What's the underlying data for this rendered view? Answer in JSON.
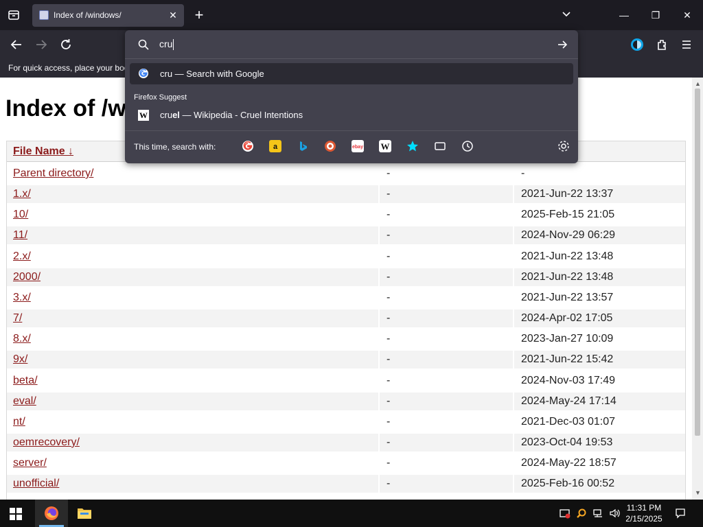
{
  "browser": {
    "tab_title": "Index of /windows/",
    "bookmarks_hint": "For quick access, place your boo"
  },
  "urlbar": {
    "typed": "cru",
    "google_row": "cru — Search with Google",
    "suggest_header": "Firefox Suggest",
    "wiki_typed": "cru",
    "wiki_completion": "el",
    "wiki_rest": " — Wikipedia - Cruel Intentions",
    "this_time_label": "This time, search with:",
    "engines": [
      "google-icon",
      "amazon-icon",
      "bing-icon",
      "duckduckgo-icon",
      "ebay-icon",
      "wikipedia-icon",
      "bookmarks-star-icon",
      "tabs-icon",
      "history-icon"
    ]
  },
  "page": {
    "heading": "Index of /w",
    "col_name": "File Name ↓",
    "rows": [
      {
        "name": "Parent directory/",
        "size": "-",
        "date": "-"
      },
      {
        "name": "1.x/",
        "size": "-",
        "date": "2021-Jun-22 13:37"
      },
      {
        "name": "10/",
        "size": "-",
        "date": "2025-Feb-15 21:05"
      },
      {
        "name": "11/",
        "size": "-",
        "date": "2024-Nov-29 06:29"
      },
      {
        "name": "2.x/",
        "size": "-",
        "date": "2021-Jun-22 13:48"
      },
      {
        "name": "2000/",
        "size": "-",
        "date": "2021-Jun-22 13:48"
      },
      {
        "name": "3.x/",
        "size": "-",
        "date": "2021-Jun-22 13:57"
      },
      {
        "name": "7/",
        "size": "-",
        "date": "2024-Apr-02 17:05"
      },
      {
        "name": "8.x/",
        "size": "-",
        "date": "2023-Jan-27 10:09"
      },
      {
        "name": "9x/",
        "size": "-",
        "date": "2021-Jun-22 15:42"
      },
      {
        "name": "beta/",
        "size": "-",
        "date": "2024-Nov-03 17:49"
      },
      {
        "name": "eval/",
        "size": "-",
        "date": "2024-May-24 17:14"
      },
      {
        "name": "nt/",
        "size": "-",
        "date": "2021-Dec-03 01:07"
      },
      {
        "name": "oemrecovery/",
        "size": "-",
        "date": "2023-Oct-04 19:53"
      },
      {
        "name": "server/",
        "size": "-",
        "date": "2024-May-22 18:57"
      },
      {
        "name": "unofficial/",
        "size": "-",
        "date": "2025-Feb-16 00:52"
      }
    ]
  },
  "taskbar": {
    "time": "11:31 PM",
    "date": "2/15/2025"
  },
  "colors": {
    "link": "#8b1a1a",
    "chrome_dark": "#1c1b22",
    "toolbar": "#2b2a33",
    "popup": "#42414d"
  }
}
